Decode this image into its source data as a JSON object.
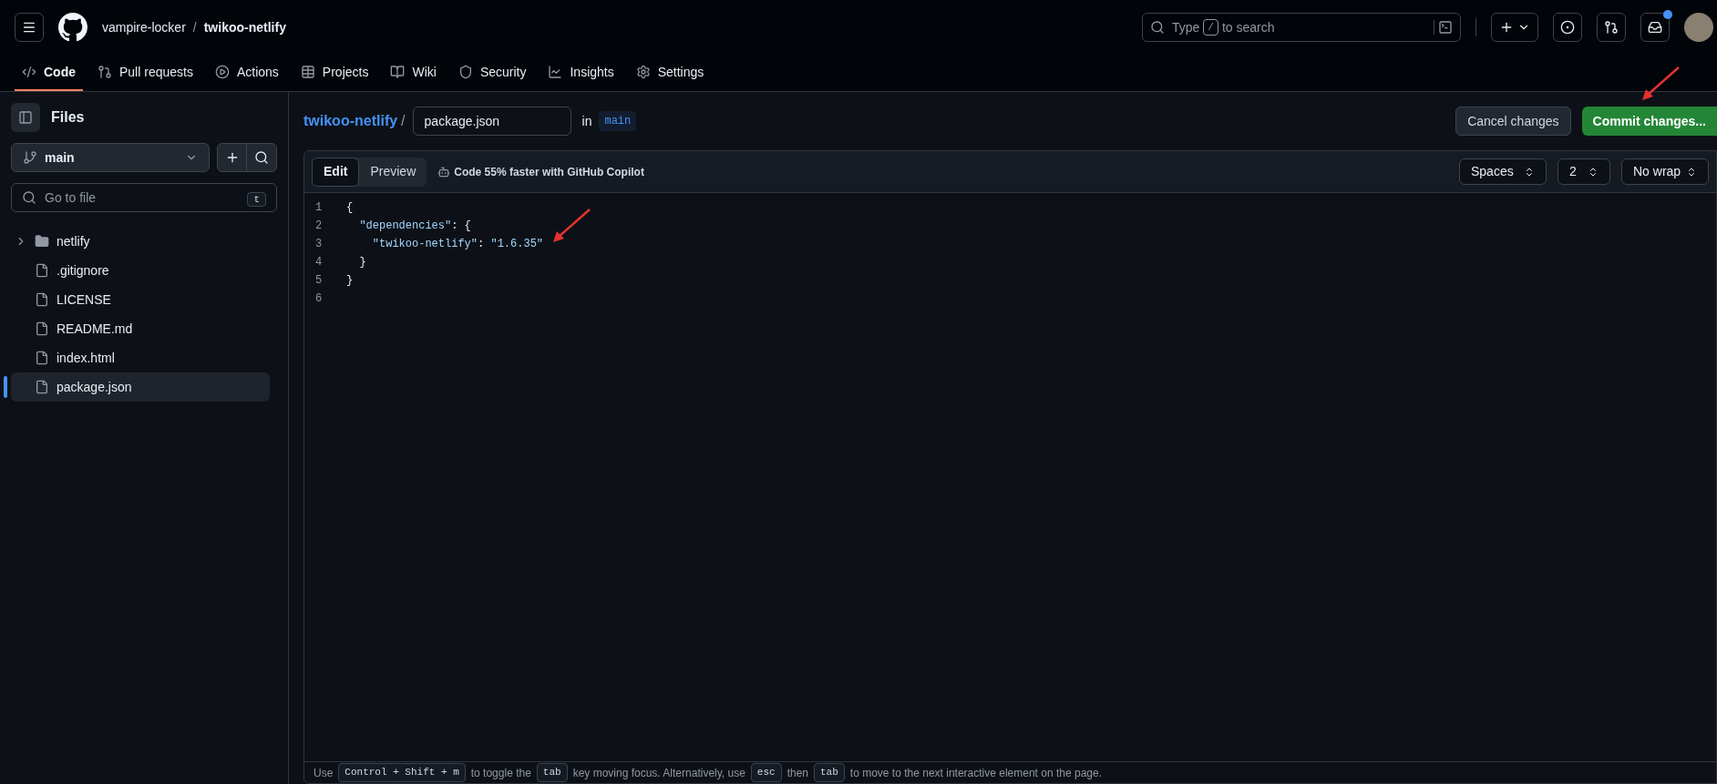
{
  "header": {
    "owner": "vampire-locker",
    "separator": "/",
    "repo": "twikoo-netlify",
    "search": {
      "placeholder_before": "Type",
      "key": "/",
      "placeholder_after": "to search"
    },
    "notification_dot": true
  },
  "repo_tabs": [
    {
      "label": "Code",
      "selected": true
    },
    {
      "label": "Pull requests",
      "selected": false
    },
    {
      "label": "Actions",
      "selected": false
    },
    {
      "label": "Projects",
      "selected": false
    },
    {
      "label": "Wiki",
      "selected": false
    },
    {
      "label": "Security",
      "selected": false
    },
    {
      "label": "Insights",
      "selected": false
    },
    {
      "label": "Settings",
      "selected": false
    }
  ],
  "sidebar": {
    "title": "Files",
    "branch": "main",
    "filter": {
      "placeholder": "Go to file",
      "key": "t"
    },
    "items": [
      {
        "kind": "folder",
        "name": "netlify",
        "expanded": false,
        "selected": false
      },
      {
        "kind": "file",
        "name": ".gitignore",
        "selected": false
      },
      {
        "kind": "file",
        "name": "LICENSE",
        "selected": false
      },
      {
        "kind": "file",
        "name": "README.md",
        "selected": false
      },
      {
        "kind": "file",
        "name": "index.html",
        "selected": false
      },
      {
        "kind": "file",
        "name": "package.json",
        "selected": true
      }
    ]
  },
  "breadcrumb": {
    "repo": "twikoo-netlify",
    "separator": "/",
    "filename": "package.json",
    "in": "in",
    "branch": "main"
  },
  "actions": {
    "cancel": "Cancel changes",
    "commit": "Commit changes..."
  },
  "editor": {
    "tabs": [
      {
        "label": "Edit",
        "selected": true
      },
      {
        "label": "Preview",
        "selected": false
      }
    ],
    "copilot": "Code 55% faster with GitHub Copilot",
    "selects": [
      "Spaces",
      "2",
      "No wrap"
    ],
    "lines": [
      {
        "number": "1",
        "tokens": [
          {
            "kind": "punct",
            "text": "{"
          }
        ]
      },
      {
        "number": "2",
        "tokens": [
          {
            "kind": "key",
            "text": "  \"dependencies\""
          },
          {
            "kind": "punct",
            "text": ": {"
          }
        ]
      },
      {
        "number": "3",
        "tokens": [
          {
            "kind": "key",
            "text": "    \"twikoo-netlify\""
          },
          {
            "kind": "punct",
            "text": ": "
          },
          {
            "kind": "string",
            "text": "\"1.6.35\""
          }
        ]
      },
      {
        "number": "4",
        "tokens": [
          {
            "kind": "punct",
            "text": "  }"
          }
        ]
      },
      {
        "number": "5",
        "tokens": [
          {
            "kind": "punct",
            "text": "}"
          }
        ]
      },
      {
        "number": "6"
      }
    ],
    "footer": [
      {
        "kind": "text",
        "text": "Use"
      },
      {
        "kind": "kbd",
        "text": "Control + Shift + m"
      },
      {
        "kind": "text",
        "text": "to toggle the"
      },
      {
        "kind": "kbd",
        "text": "tab"
      },
      {
        "kind": "text",
        "text": "key moving focus. Alternatively, use"
      },
      {
        "kind": "kbd",
        "text": "esc"
      },
      {
        "kind": "text",
        "text": "then"
      },
      {
        "kind": "kbd",
        "text": "tab"
      },
      {
        "kind": "text",
        "text": "to move to the next interactive element on the page."
      }
    ]
  },
  "annotations": [
    {
      "kind": "arrow"
    },
    {
      "kind": "arrow"
    }
  ]
}
